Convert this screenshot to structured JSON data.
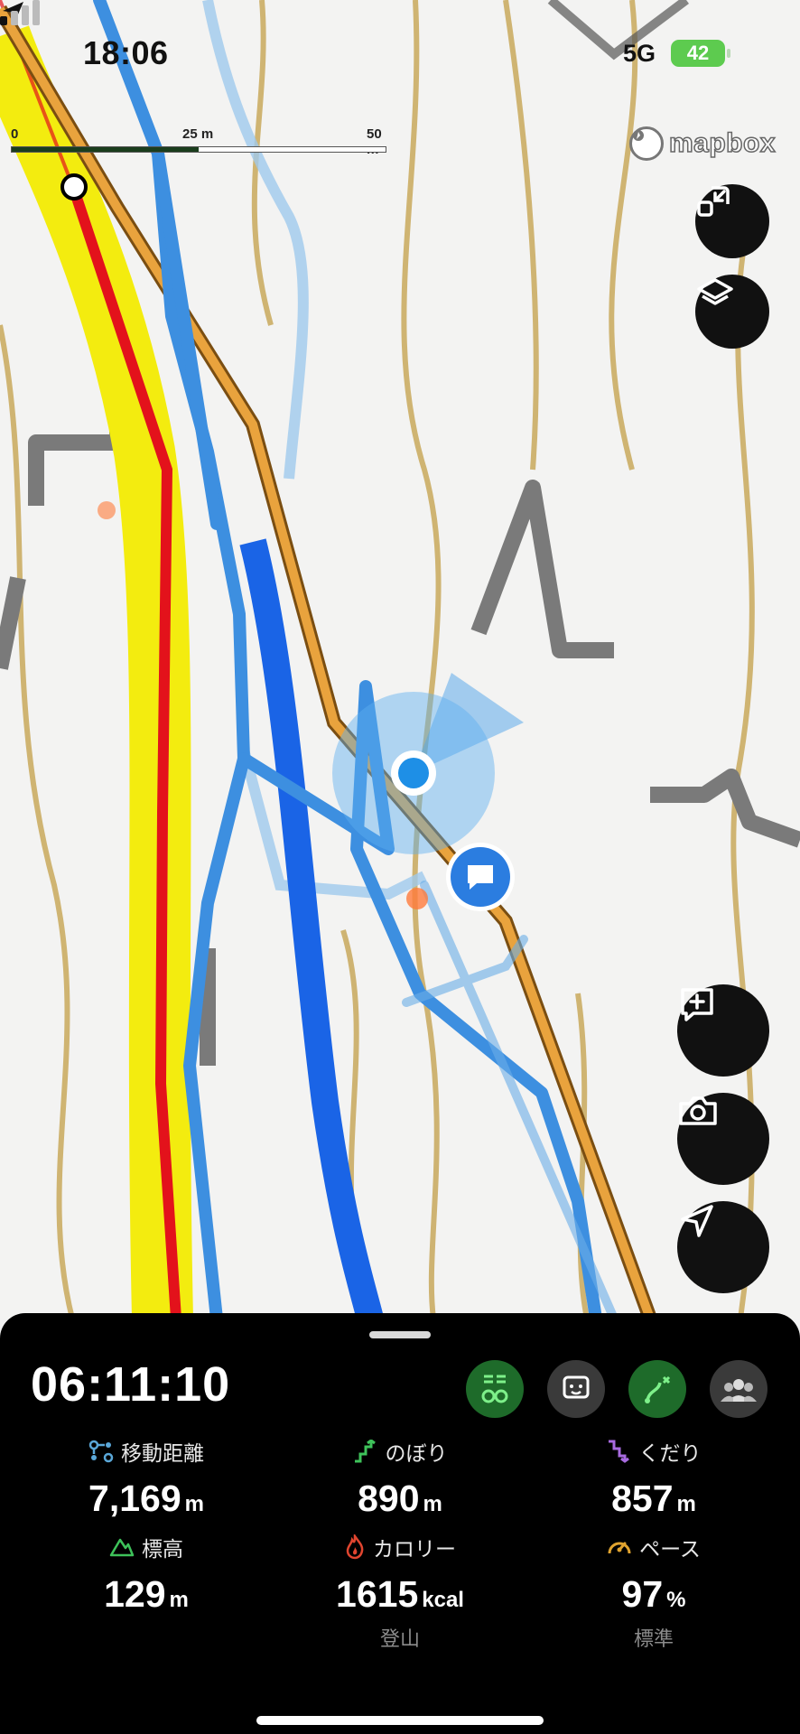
{
  "status_bar": {
    "time": "18:06",
    "network": "5G",
    "battery": "42"
  },
  "map": {
    "scale": {
      "start": "0",
      "mid": "25 m",
      "end": "50 m"
    },
    "attribution": "mapbox"
  },
  "controls": {
    "collapse": "collapse-map-icon",
    "layers": "layers-icon",
    "add_note": "add-note-icon",
    "camera": "camera-icon",
    "locate": "navigation-arrow-icon"
  },
  "panel": {
    "elapsed_time": "06:11:10",
    "stats": [
      {
        "label": "移動距離",
        "value": "7,169",
        "unit": "m",
        "sub": "",
        "icon": "route-icon",
        "color": "#5aa7d8"
      },
      {
        "label": "のぼり",
        "value": "890",
        "unit": "m",
        "sub": "",
        "icon": "ascent-icon",
        "color": "#3ec25a"
      },
      {
        "label": "くだり",
        "value": "857",
        "unit": "m",
        "sub": "",
        "icon": "descent-icon",
        "color": "#a86be0"
      },
      {
        "label": "標高",
        "value": "129",
        "unit": "m",
        "sub": "",
        "icon": "mountain-icon",
        "color": "#3ec25a"
      },
      {
        "label": "カロリー",
        "value": "1615",
        "unit": "kcal",
        "sub": "登山",
        "icon": "flame-icon",
        "color": "#e0452f"
      },
      {
        "label": "ペース",
        "value": "97",
        "unit": "%",
        "sub": "標準",
        "icon": "speedometer-icon",
        "color": "#e0a32f"
      }
    ]
  },
  "colors": {
    "route_red": "#e3121b",
    "route_yellow": "#f3ec0f",
    "track_blue": "#3d8fe0",
    "trail_orange": "#e9a33d",
    "accent_green": "#1e6b2a"
  }
}
